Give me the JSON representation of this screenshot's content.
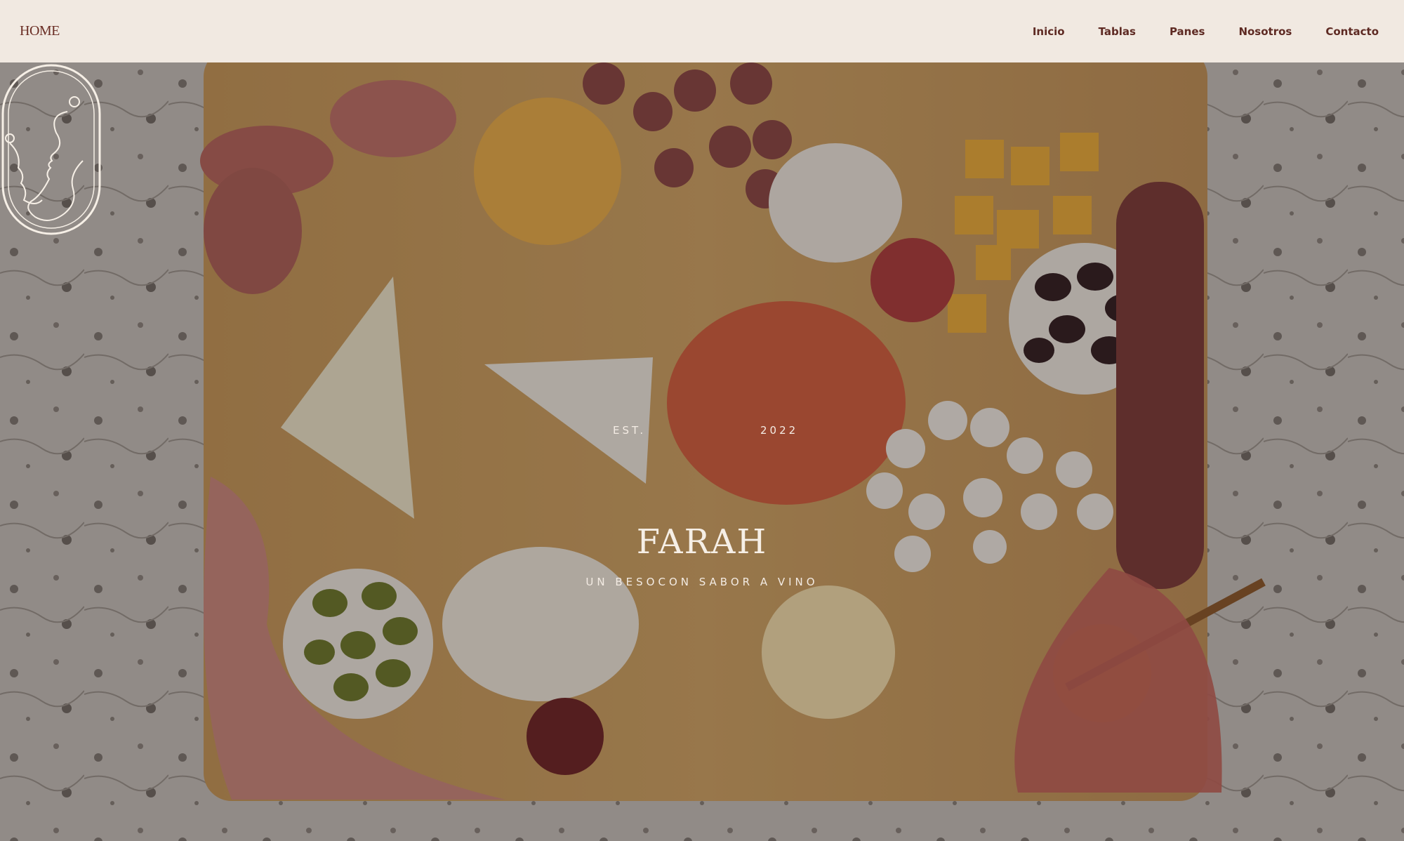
{
  "header": {
    "brand": "HOME",
    "nav": [
      "Inicio",
      "Tablas",
      "Panes",
      "Nosotros",
      "Contacto"
    ]
  },
  "hero": {
    "image": "charcuterie-board-photo",
    "logo": {
      "est": "EST.",
      "year": "2022",
      "name": "FARAH",
      "tagline": "UN BESOCON SABOR A VINO"
    }
  },
  "colors": {
    "header_bg": "#f1e9e1",
    "brand_text": "#6a2d24",
    "logo_text": "#f6efe6"
  }
}
